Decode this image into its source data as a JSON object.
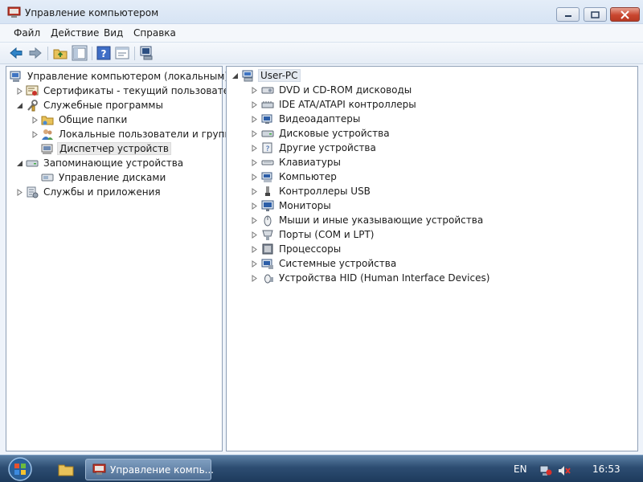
{
  "window": {
    "title": "Управление компьютером"
  },
  "menu": [
    "Файл",
    "Действие",
    "Вид",
    "Справка"
  ],
  "toolbar": {
    "buttons": [
      "back-arrow-icon",
      "forward-arrow-icon",
      "up-folder-icon",
      "show-tree-icon",
      "help-icon",
      "properties-icon",
      "scan-hardware-icon"
    ]
  },
  "left_tree": {
    "root": "Управление компьютером (локальным)",
    "items": [
      {
        "label": "Сертификаты - текущий пользователь",
        "icon": "certificate-icon"
      },
      {
        "label": "Служебные программы",
        "icon": "tools-icon"
      },
      {
        "label": "Общие папки",
        "icon": "shared-folder-icon"
      },
      {
        "label": "Локальные пользователи и группы",
        "icon": "users-icon"
      },
      {
        "label": "Диспетчер устройств",
        "icon": "device-manager-icon"
      },
      {
        "label": "Запоминающие устройства",
        "icon": "storage-icon"
      },
      {
        "label": "Управление дисками",
        "icon": "disk-management-icon"
      },
      {
        "label": "Службы и приложения",
        "icon": "services-icon"
      }
    ]
  },
  "right_tree": {
    "root": "User-PC",
    "devices": [
      "DVD и CD-ROM дисководы",
      "IDE ATA/ATAPI контроллеры",
      "Видеоадаптеры",
      "Дисковые устройства",
      "Другие устройства",
      "Клавиатуры",
      "Компьютер",
      "Контроллеры USB",
      "Мониторы",
      "Мыши и иные указывающие устройства",
      "Порты (COM и LPT)",
      "Процессоры",
      "Системные устройства",
      "Устройства HID (Human Interface Devices)"
    ]
  },
  "taskbar": {
    "active_app": "Управление компь...",
    "language": "EN",
    "clock": "16:53"
  }
}
